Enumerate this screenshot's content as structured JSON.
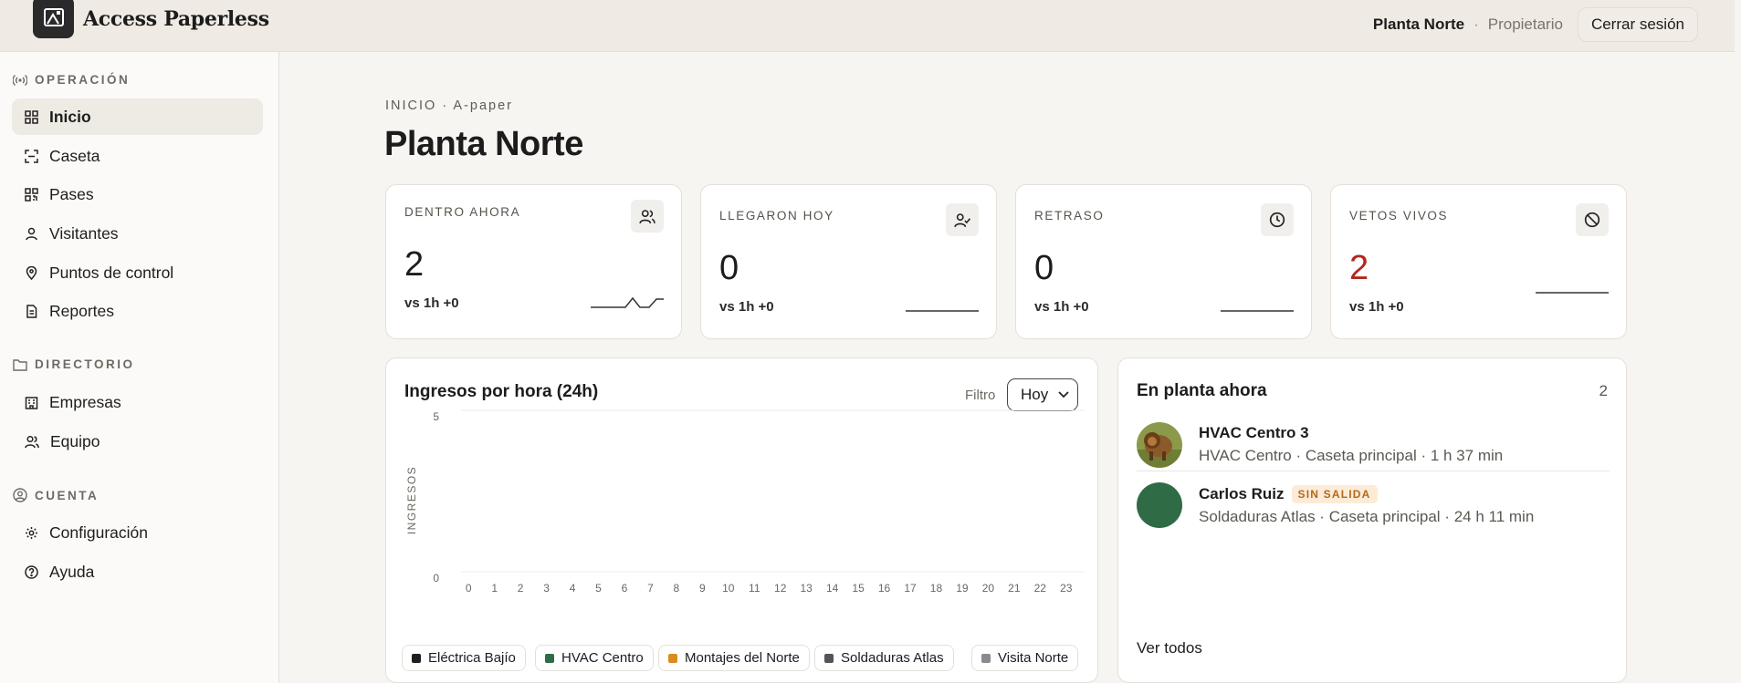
{
  "app": {
    "brand": "Access Paperless"
  },
  "topbar": {
    "plant": "Planta Norte",
    "separator": "·",
    "role": "Propietario",
    "logout_label": "Cerrar sesión"
  },
  "sidebar": {
    "sections": [
      {
        "title": "OPERACIÓN",
        "icon": "broadcast-icon"
      },
      {
        "title": "DIRECTORIO",
        "icon": "folder-icon"
      },
      {
        "title": "CUENTA",
        "icon": "user-circle-icon"
      }
    ],
    "items": [
      {
        "label": "Inicio",
        "icon": "grid-icon",
        "active": true
      },
      {
        "label": "Caseta",
        "icon": "scan-icon"
      },
      {
        "label": "Pases",
        "icon": "qr-icon"
      },
      {
        "label": "Visitantes",
        "icon": "user-icon"
      },
      {
        "label": "Puntos de control",
        "icon": "map-pin-icon"
      },
      {
        "label": "Reportes",
        "icon": "report-icon"
      },
      {
        "label": "Empresas",
        "icon": "building-icon"
      },
      {
        "label": "Equipo",
        "icon": "users-icon"
      },
      {
        "label": "Configuración",
        "icon": "gear-icon"
      },
      {
        "label": "Ayuda",
        "icon": "help-icon"
      }
    ]
  },
  "page": {
    "breadcrumb": "INICIO · A-paper",
    "title": "Planta Norte"
  },
  "stats": [
    {
      "label": "DENTRO AHORA",
      "value": "2",
      "delta_prefix": "vs 1h ",
      "delta": "+0",
      "icon": "users-icon",
      "color": "#1c1c1c"
    },
    {
      "label": "LLEGARON HOY",
      "value": "0",
      "delta_prefix": "vs 1h ",
      "delta": "+0",
      "icon": "user-check-icon",
      "color": "#1c1c1c"
    },
    {
      "label": "RETRASO",
      "value": "0",
      "delta_prefix": "vs 1h ",
      "delta": "+0",
      "icon": "clock-icon",
      "color": "#1c1c1c"
    },
    {
      "label": "VETOS VIVOS",
      "value": "2",
      "delta_prefix": "vs 1h ",
      "delta": "+0",
      "icon": "ban-icon",
      "color": "#b3261e"
    }
  ],
  "chart": {
    "title": "Ingresos por hora (24h)",
    "filter_label": "Filtro",
    "filter_value": "Hoy",
    "filter_options": [
      "Hoy"
    ]
  },
  "chart_data": {
    "type": "bar",
    "title": "Ingresos por hora (24h)",
    "xlabel": "",
    "ylabel": "INGRESOS",
    "categories": [
      "0",
      "1",
      "2",
      "3",
      "4",
      "5",
      "6",
      "7",
      "8",
      "9",
      "10",
      "11",
      "12",
      "13",
      "14",
      "15",
      "16",
      "17",
      "18",
      "19",
      "20",
      "21",
      "22",
      "23"
    ],
    "ylim": [
      0,
      5
    ],
    "yticks": [
      "5",
      "0"
    ],
    "series": [
      {
        "name": "Eléctrica Bajío",
        "color": "#1f1f1f",
        "values": [
          0,
          0,
          0,
          0,
          0,
          0,
          0,
          0,
          0,
          0,
          0,
          0,
          0,
          0,
          0,
          0,
          0,
          0,
          0,
          0,
          0,
          0,
          0,
          0
        ]
      },
      {
        "name": "HVAC Centro",
        "color": "#2f6b45",
        "values": [
          0,
          0,
          0,
          0,
          0,
          0,
          0,
          0,
          0,
          0,
          0,
          0,
          0,
          0,
          0,
          0,
          0,
          0,
          0,
          0,
          0,
          0,
          0,
          0
        ]
      },
      {
        "name": "Montajes del Norte",
        "color": "#d98c1f",
        "values": [
          0,
          0,
          0,
          0,
          0,
          0,
          0,
          0,
          0,
          0,
          0,
          0,
          0,
          0,
          0,
          0,
          0,
          0,
          0,
          0,
          0,
          0,
          0,
          0
        ]
      },
      {
        "name": "Soldaduras Atlas",
        "color": "#555555",
        "values": [
          0,
          0,
          0,
          0,
          0,
          0,
          0,
          0,
          0,
          0,
          0,
          0,
          0,
          0,
          0,
          0,
          0,
          0,
          0,
          0,
          0,
          0,
          0,
          0
        ]
      },
      {
        "name": "Visita Norte",
        "color": "#8a8a8a",
        "values": [
          0,
          0,
          0,
          0,
          0,
          0,
          0,
          0,
          0,
          0,
          0,
          0,
          0,
          0,
          0,
          0,
          0,
          0,
          0,
          0,
          0,
          0,
          0,
          0
        ]
      }
    ],
    "legend": "bottom",
    "grid": true
  },
  "panel": {
    "title": "En planta ahora",
    "count": "2",
    "people": [
      {
        "name": "HVAC Centro 3",
        "sub": "HVAC Centro · Caseta principal · 1 h 37 min",
        "badge": "",
        "avatar": "photo"
      },
      {
        "name": "Carlos Ruiz",
        "sub": "Soldaduras Atlas · Caseta principal · 24 h 11 min",
        "badge": "SIN SALIDA",
        "avatar": "#2f6b45"
      }
    ],
    "see_all": "Ver todos"
  }
}
